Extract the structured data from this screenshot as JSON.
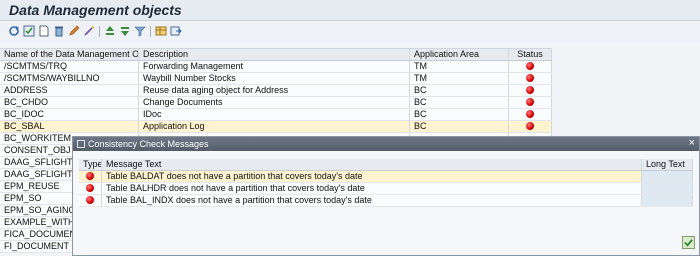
{
  "page": {
    "title": "Data Management objects"
  },
  "toolbar": {
    "buttons": [
      {
        "icon": "refresh-icon"
      },
      {
        "icon": "check-icon"
      },
      {
        "icon": "new-document-icon"
      },
      {
        "icon": "delete-icon"
      },
      {
        "icon": "edit-pencil-icon"
      },
      {
        "icon": "magic-wand-icon"
      },
      {
        "icon": "sort-ascending-icon"
      },
      {
        "icon": "sort-descending-icon"
      },
      {
        "icon": "filter-icon"
      },
      {
        "icon": "layout-grid-icon"
      },
      {
        "icon": "export-icon"
      }
    ]
  },
  "table": {
    "columns": {
      "name": "Name of the Data Management Obje...",
      "description": "Description",
      "area": "Application Area",
      "status": "Status"
    },
    "rows": [
      {
        "name": "/SCMTMS/TRQ",
        "description": "Forwarding Management",
        "area": "TM",
        "status": "red"
      },
      {
        "name": "/SCMTMS/WAYBILLNO",
        "description": "Waybill Number Stocks",
        "area": "TM",
        "status": "red"
      },
      {
        "name": "ADDRESS",
        "description": "Reuse data aging object for Address",
        "area": "BC",
        "status": "red"
      },
      {
        "name": "BC_CHDO",
        "description": "Change Documents",
        "area": "BC",
        "status": "red"
      },
      {
        "name": "BC_IDOC",
        "description": "IDoc",
        "area": "BC",
        "status": "red"
      },
      {
        "name": "BC_SBAL",
        "description": "Application Log",
        "area": "BC",
        "status": "red"
      },
      {
        "name": "BC_WORKITEM",
        "description": "",
        "area": "",
        "status": ""
      },
      {
        "name": "CONSENT_OBJ",
        "description": "",
        "area": "",
        "status": ""
      },
      {
        "name": "DAAG_SFLIGHT",
        "description": "",
        "area": "",
        "status": ""
      },
      {
        "name": "DAAG_SFLIGHT_RU",
        "description": "",
        "area": "",
        "status": ""
      },
      {
        "name": "EPM_REUSE",
        "description": "",
        "area": "",
        "status": ""
      },
      {
        "name": "EPM_SO",
        "description": "",
        "area": "",
        "status": ""
      },
      {
        "name": "EPM_SO_AGING_R",
        "description": "",
        "area": "",
        "status": ""
      },
      {
        "name": "EXAMPLE_WITH_R",
        "description": "",
        "area": "",
        "status": ""
      },
      {
        "name": "FICA_DOCUMENT",
        "description": "",
        "area": "",
        "status": ""
      },
      {
        "name": "FI_DOCUMENT",
        "description": "",
        "area": "",
        "status": ""
      }
    ]
  },
  "dialog": {
    "title": "Consistency Check Messages",
    "close": "×",
    "columns": {
      "type": "Type",
      "text": "Message Text",
      "long": "Long Text"
    },
    "messages": [
      {
        "text": "Table BALDAT does not have a partition that covers today's date"
      },
      {
        "text": "Table BALHDR does not have a partition that covers today's date"
      },
      {
        "text": "Table BAL_INDX does not have a partition that covers today's date"
      }
    ],
    "ok_icon": "confirm-check-icon"
  },
  "colors": {
    "status_red": "#d10000",
    "selection": "#fff4cf",
    "dialog_title": "#5f6875"
  }
}
